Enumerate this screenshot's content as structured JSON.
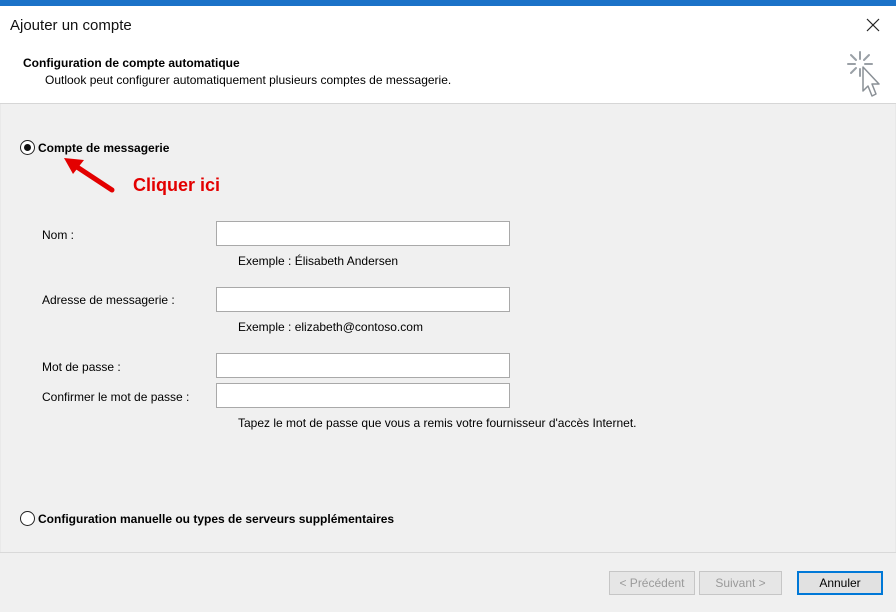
{
  "window": {
    "title": "Ajouter un compte"
  },
  "header": {
    "title": "Configuration de compte automatique",
    "description": "Outlook peut configurer automatiquement plusieurs comptes de messagerie."
  },
  "options": {
    "email_account": {
      "label": "Compte de messagerie",
      "selected": true
    },
    "manual": {
      "label": "Configuration manuelle ou types de serveurs supplémentaires",
      "selected": false
    }
  },
  "annotation": {
    "text": "Cliquer ici",
    "color": "#e30000"
  },
  "form": {
    "name": {
      "label": "Nom :",
      "value": "",
      "hint": "Exemple : Élisabeth Andersen"
    },
    "email": {
      "label": "Adresse de messagerie :",
      "value": "",
      "hint": "Exemple : elizabeth@contoso.com"
    },
    "password": {
      "label": "Mot de passe :",
      "value": ""
    },
    "confirm_password": {
      "label": "Confirmer le mot de passe :",
      "value": "",
      "hint": "Tapez le mot de passe que vous a remis votre fournisseur d'accès Internet."
    }
  },
  "buttons": {
    "previous": "< Précédent",
    "next": "Suivant >",
    "cancel": "Annuler"
  },
  "colors": {
    "accent": "#1b72c8",
    "focus_border": "#0078d7"
  }
}
